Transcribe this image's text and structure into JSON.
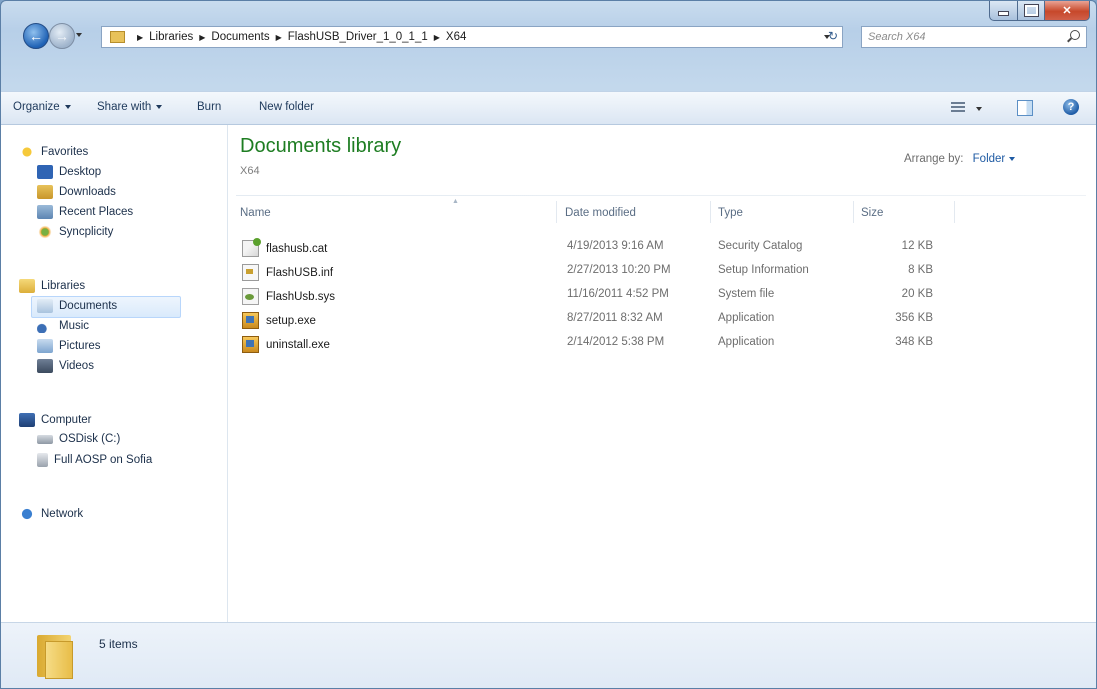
{
  "window": {
    "caption_buttons": [
      "minimize",
      "maximize",
      "close"
    ]
  },
  "address_bar": {
    "crumbs": [
      "Libraries",
      "Documents",
      "FlashUSB_Driver_1_0_1_1",
      "X64"
    ]
  },
  "search": {
    "placeholder": "Search X64"
  },
  "toolbar": {
    "organize": "Organize",
    "share_with": "Share with",
    "burn": "Burn",
    "new_folder": "New folder"
  },
  "sidebar": {
    "favorites": {
      "label": "Favorites",
      "items": [
        "Desktop",
        "Downloads",
        "Recent Places",
        "Syncplicity"
      ]
    },
    "libraries": {
      "label": "Libraries",
      "items": [
        "Documents",
        "Music",
        "Pictures",
        "Videos"
      ],
      "selected": "Documents"
    },
    "computer": {
      "label": "Computer",
      "items": [
        "OSDisk (C:)",
        "Full AOSP on Sofia"
      ]
    },
    "network": {
      "label": "Network"
    }
  },
  "library": {
    "title": "Documents library",
    "subtitle": "X64",
    "arrange_label": "Arrange by:",
    "arrange_value": "Folder"
  },
  "columns": {
    "name": "Name",
    "date": "Date modified",
    "type": "Type",
    "size": "Size"
  },
  "files": [
    {
      "name": "flashusb.cat",
      "date": "4/19/2013 9:16 AM",
      "type": "Security Catalog",
      "size": "12 KB",
      "icon": "catalog-file-icon"
    },
    {
      "name": "FlashUSB.inf",
      "date": "2/27/2013 10:20 PM",
      "type": "Setup Information",
      "size": "8 KB",
      "icon": "inf-file-icon"
    },
    {
      "name": "FlashUsb.sys",
      "date": "11/16/2011 4:52 PM",
      "type": "System file",
      "size": "20 KB",
      "icon": "system-file-icon"
    },
    {
      "name": "setup.exe",
      "date": "8/27/2011 8:32 AM",
      "type": "Application",
      "size": "356 KB",
      "icon": "installer-exe-icon"
    },
    {
      "name": "uninstall.exe",
      "date": "2/14/2012 5:38 PM",
      "type": "Application",
      "size": "348 KB",
      "icon": "installer-exe-icon"
    }
  ],
  "status": {
    "count": "5 items"
  },
  "colors": {
    "title_green": "#1e7d22",
    "selection": "#d9eafc",
    "toolbar_text": "#1e395b"
  }
}
